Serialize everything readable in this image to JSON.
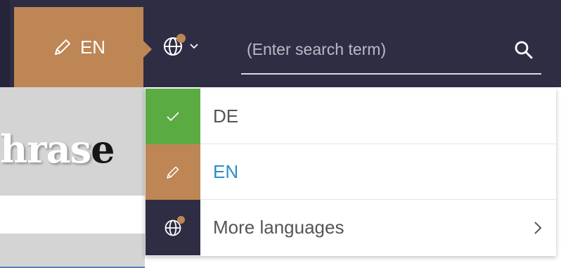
{
  "header": {
    "current_language_label": "EN",
    "search": {
      "placeholder": "(Enter search term)",
      "value": ""
    }
  },
  "background": {
    "logo_text_light": "hras",
    "logo_text_dark": "e"
  },
  "language_menu": {
    "items": [
      {
        "label": "DE",
        "icon": "check-icon",
        "status": "active"
      },
      {
        "label": "EN",
        "icon": "pencil-icon",
        "status": "editing"
      },
      {
        "label": "More languages",
        "icon": "globe-icon",
        "status": "submenu"
      }
    ]
  },
  "colors": {
    "header_bg": "#2e2d44",
    "accent_orange": "#bd8654",
    "active_green": "#5bab43",
    "link_blue": "#2b8ec8"
  }
}
